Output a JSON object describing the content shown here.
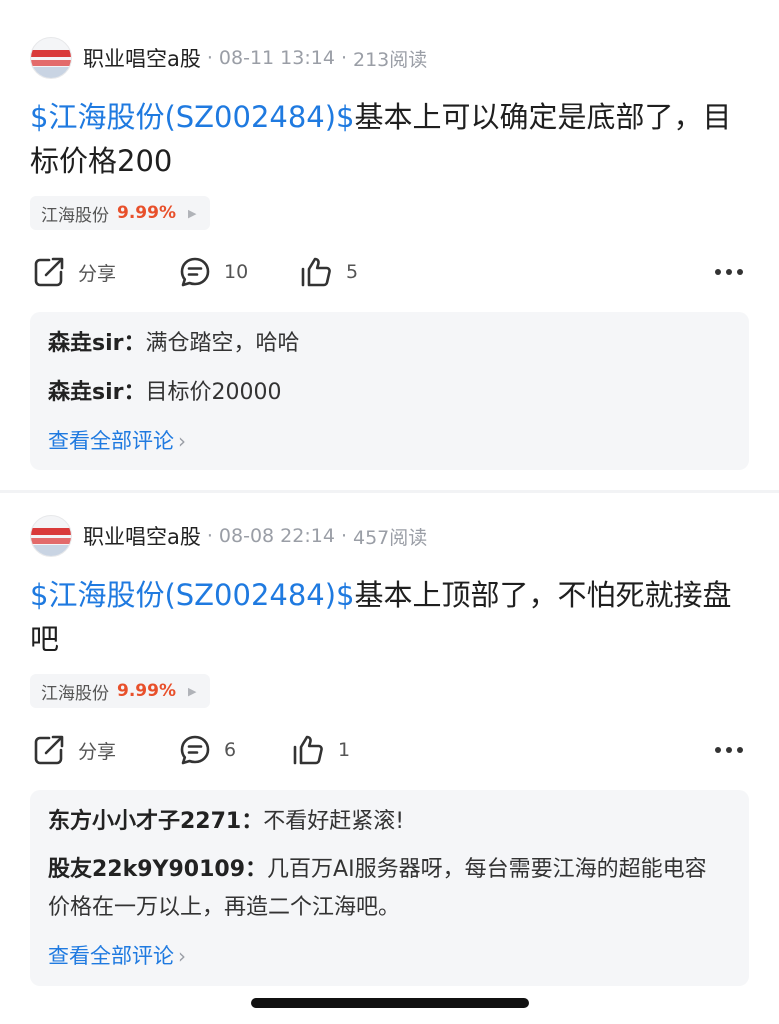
{
  "posts": [
    {
      "author": "职业唱空a股",
      "date": "08-11 13:14",
      "reads": "213阅读",
      "stock_link": "$江海股份(SZ002484)$",
      "body": "基本上可以确定是底部了，目标价格200",
      "tag": {
        "name": "江海股份",
        "change": "9.99%"
      },
      "actions": {
        "share": "分享",
        "comments": "10",
        "likes": "5"
      },
      "comments": [
        {
          "user": "森垚sir",
          "text": "满仓踏空，哈哈"
        },
        {
          "user": "森垚sir",
          "text": "目标价20000"
        }
      ],
      "view_all": "查看全部评论"
    },
    {
      "author": "职业唱空a股",
      "date": "08-08 22:14",
      "reads": "457阅读",
      "stock_link": "$江海股份(SZ002484)$",
      "body": "基本上顶部了，不怕死就接盘吧",
      "tag": {
        "name": "江海股份",
        "change": "9.99%"
      },
      "actions": {
        "share": "分享",
        "comments": "6",
        "likes": "1"
      },
      "comments": [
        {
          "user": "东方小小才子2271",
          "text": "不看好赶紧滚!"
        },
        {
          "user": "股友22k9Y90109",
          "text": "几百万AI服务器呀，每台需要江海的超能电容价格在一万以上，再造二个江海吧。"
        }
      ],
      "view_all": "查看全部评论"
    }
  ],
  "sep": "·",
  "colors": {
    "link": "#1f7ae0",
    "up": "#e8502b",
    "muted": "#9a9ea6"
  }
}
